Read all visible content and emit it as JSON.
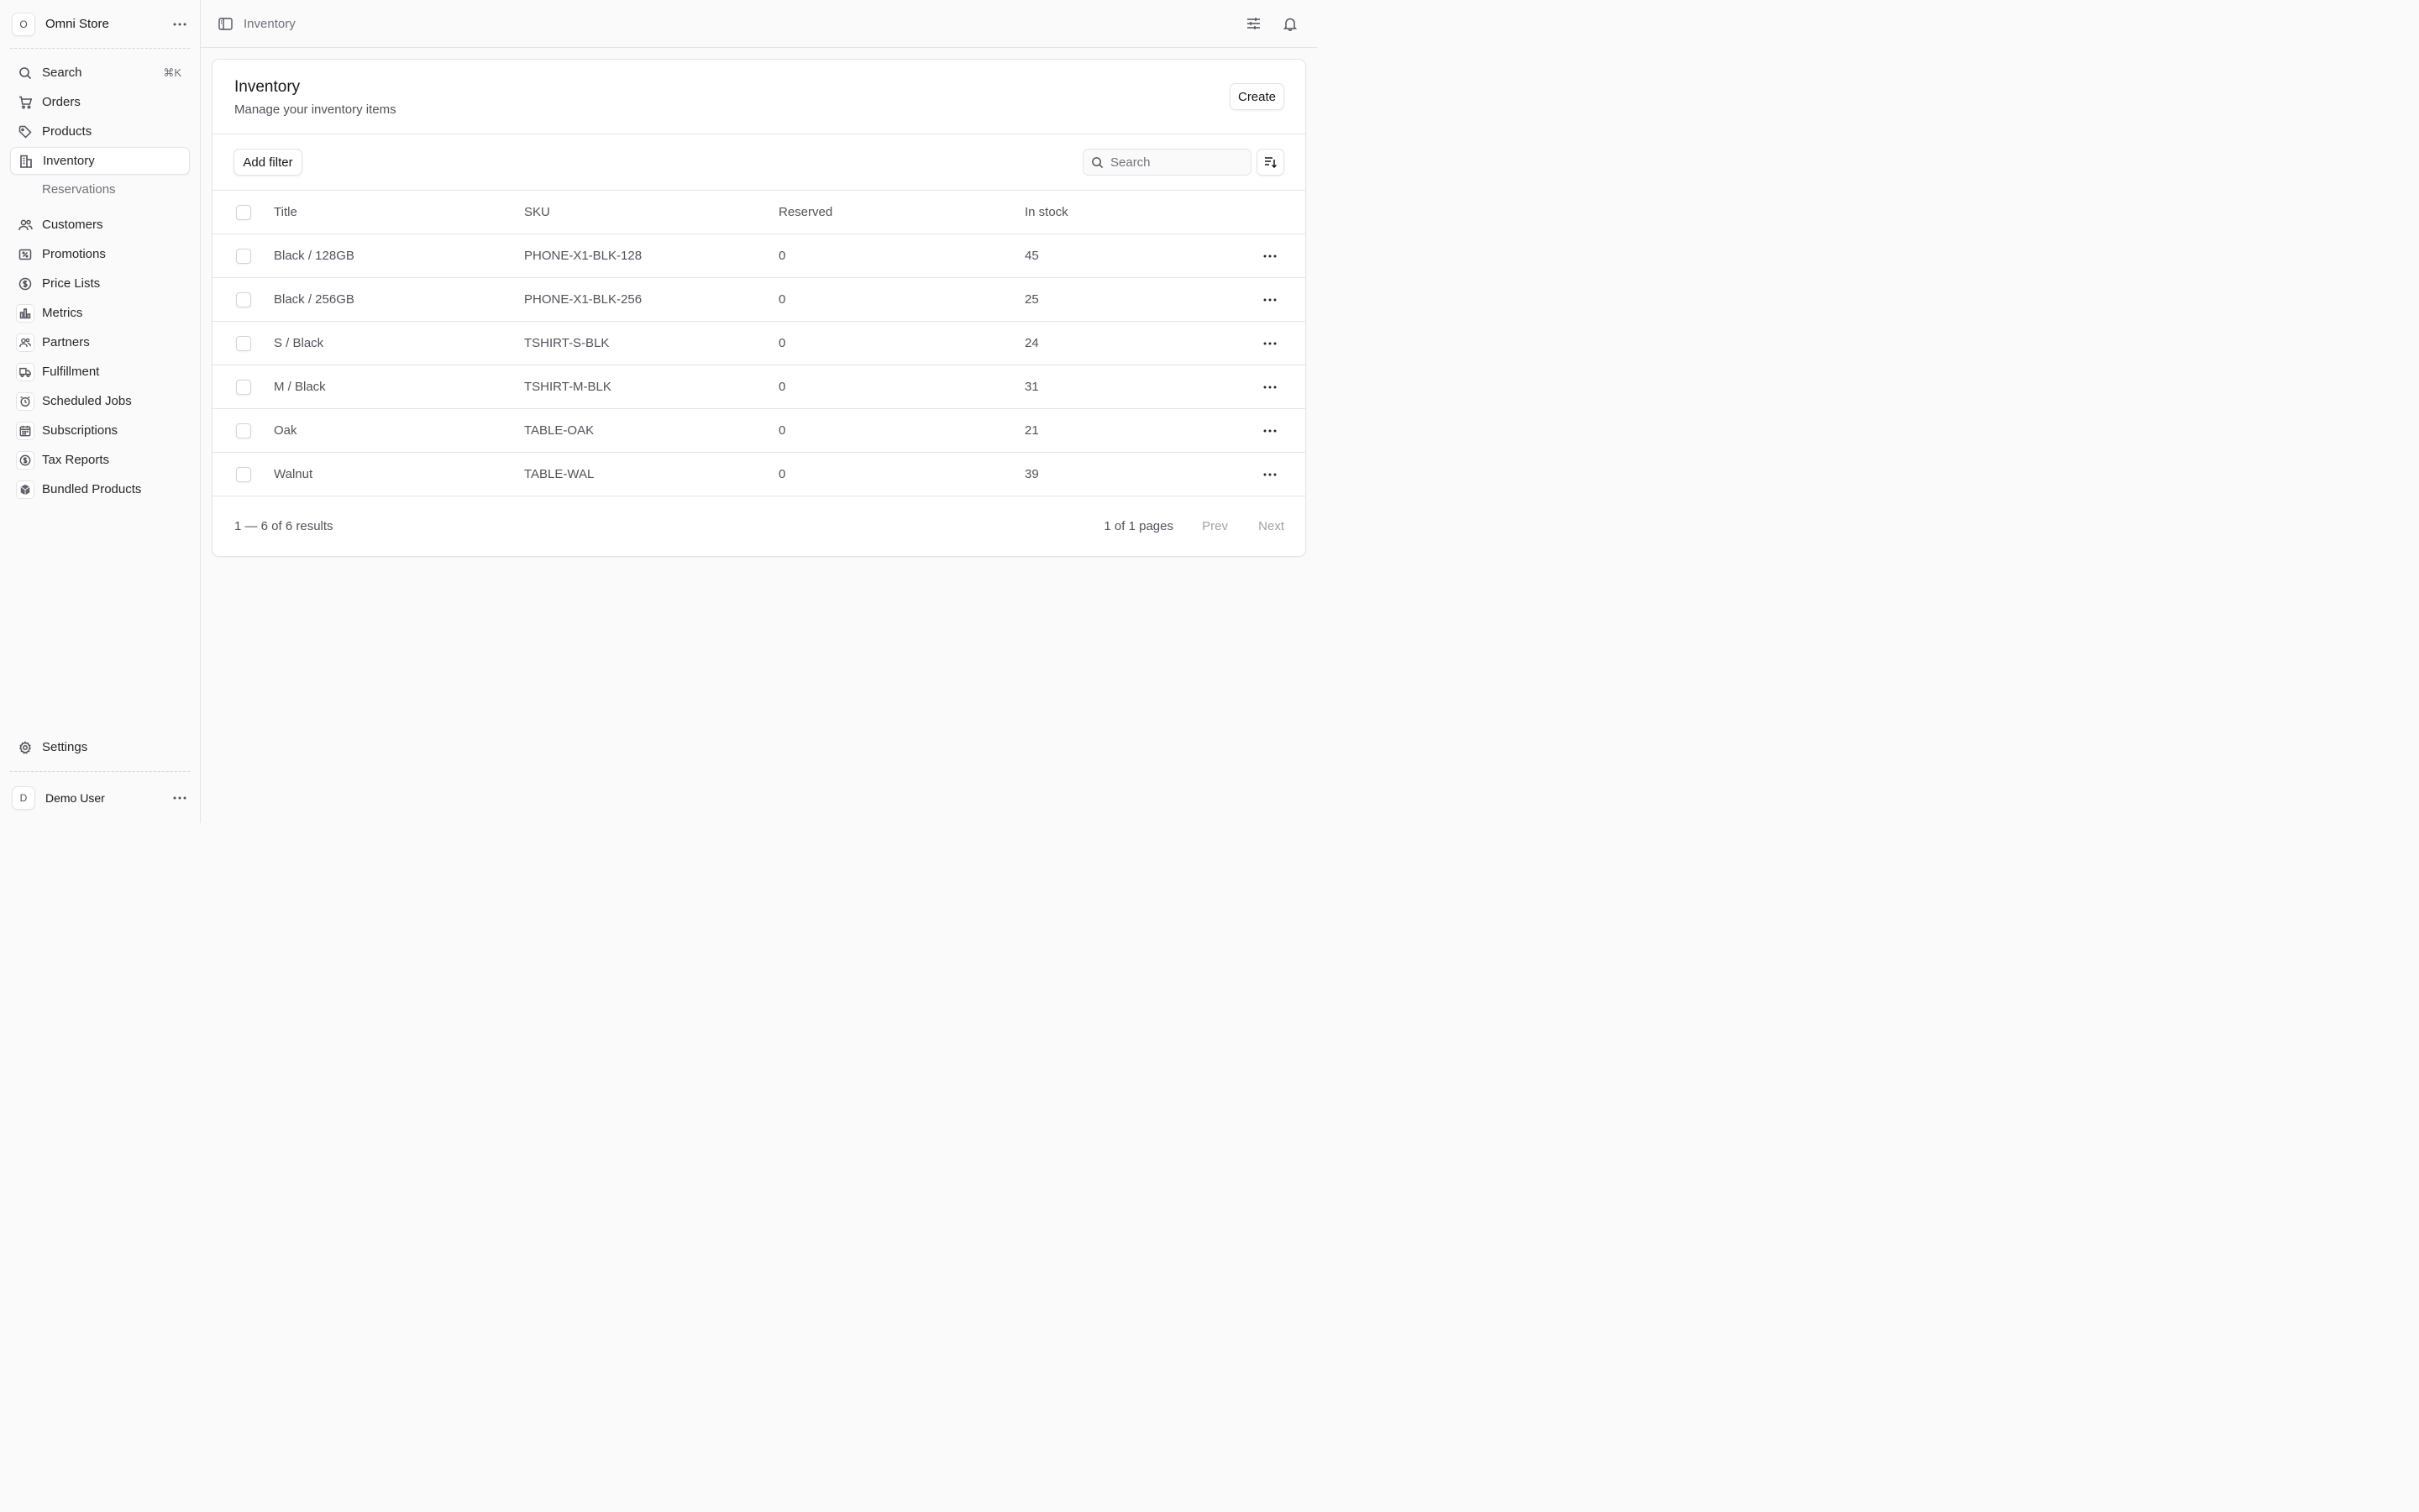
{
  "store": {
    "initial": "O",
    "name": "Omni Store"
  },
  "nav": {
    "search": {
      "label": "Search",
      "shortcut": "⌘K"
    },
    "orders": "Orders",
    "products": "Products",
    "inventory": "Inventory",
    "reservations": "Reservations",
    "customers": "Customers",
    "promotions": "Promotions",
    "price_lists": "Price Lists",
    "metrics": "Metrics",
    "partners": "Partners",
    "fulfillment": "Fulfillment",
    "scheduled_jobs": "Scheduled Jobs",
    "subscriptions": "Subscriptions",
    "tax_reports": "Tax Reports",
    "bundled_products": "Bundled Products",
    "settings": "Settings"
  },
  "user": {
    "initial": "D",
    "name": "Demo User"
  },
  "topbar": {
    "breadcrumb": "Inventory"
  },
  "page": {
    "title": "Inventory",
    "subtitle": "Manage your inventory items",
    "create_label": "Create",
    "add_filter_label": "Add filter",
    "search_placeholder": "Search"
  },
  "table": {
    "headers": {
      "title": "Title",
      "sku": "SKU",
      "reserved": "Reserved",
      "in_stock": "In stock"
    },
    "rows": [
      {
        "title": "Black / 128GB",
        "sku": "PHONE-X1-BLK-128",
        "reserved": "0",
        "in_stock": "45"
      },
      {
        "title": "Black / 256GB",
        "sku": "PHONE-X1-BLK-256",
        "reserved": "0",
        "in_stock": "25"
      },
      {
        "title": "S / Black",
        "sku": "TSHIRT-S-BLK",
        "reserved": "0",
        "in_stock": "24"
      },
      {
        "title": "M / Black",
        "sku": "TSHIRT-M-BLK",
        "reserved": "0",
        "in_stock": "31"
      },
      {
        "title": "Oak",
        "sku": "TABLE-OAK",
        "reserved": "0",
        "in_stock": "21"
      },
      {
        "title": "Walnut",
        "sku": "TABLE-WAL",
        "reserved": "0",
        "in_stock": "39"
      }
    ]
  },
  "pagination": {
    "results": "1 — 6 of 6 results",
    "pages": "1 of 1 pages",
    "prev": "Prev",
    "next": "Next"
  }
}
